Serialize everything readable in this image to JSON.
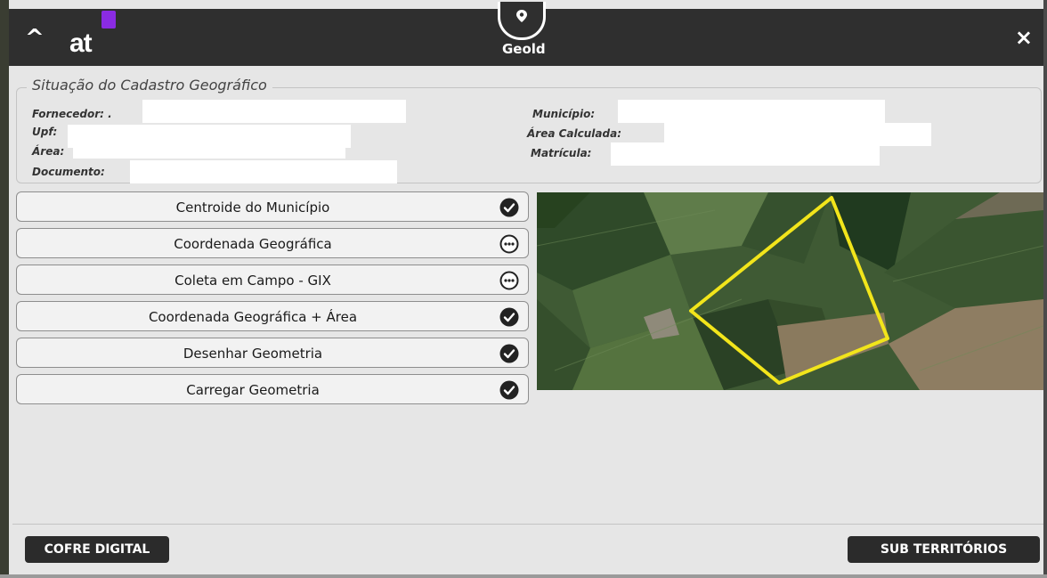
{
  "titlebar": {
    "logo_text": "at",
    "title": "Geold",
    "close_glyph": "×",
    "collapse_glyph": "^"
  },
  "status": {
    "title": "Situação do Cadastro Geográfico",
    "fields_left": [
      {
        "label": "Fornecedor: ."
      },
      {
        "label": "Upf:"
      },
      {
        "label": "Área:"
      },
      {
        "label": "Documento:"
      }
    ],
    "fields_right": [
      {
        "label": "Município:"
      },
      {
        "label": "Área Calculada:"
      },
      {
        "label": "Matrícula:"
      }
    ]
  },
  "options": [
    {
      "label": "Centroide do Município",
      "state": "done"
    },
    {
      "label": "Coordenada Geográfica",
      "state": "pending"
    },
    {
      "label": "Coleta em Campo - GIX",
      "state": "pending"
    },
    {
      "label": "Coordenada Geográfica + Área",
      "state": "done"
    },
    {
      "label": "Desenhar Geometria",
      "state": "done"
    },
    {
      "label": "Carregar Geometria",
      "state": "done"
    }
  ],
  "footer": {
    "left_button": "COFRE DIGITAL",
    "right_button": "SUB TERRITÓRIOS"
  },
  "icons": {
    "done": "check-circle-icon",
    "pending": "ellipsis-circle-icon",
    "collapse": "chevron-up-icon",
    "close": "close-icon",
    "badge": "map-pin-icon"
  },
  "colors": {
    "titlebar": "#2f2f2f",
    "polygon": "#f2e51b",
    "brand_accent": "#8a2be2"
  }
}
